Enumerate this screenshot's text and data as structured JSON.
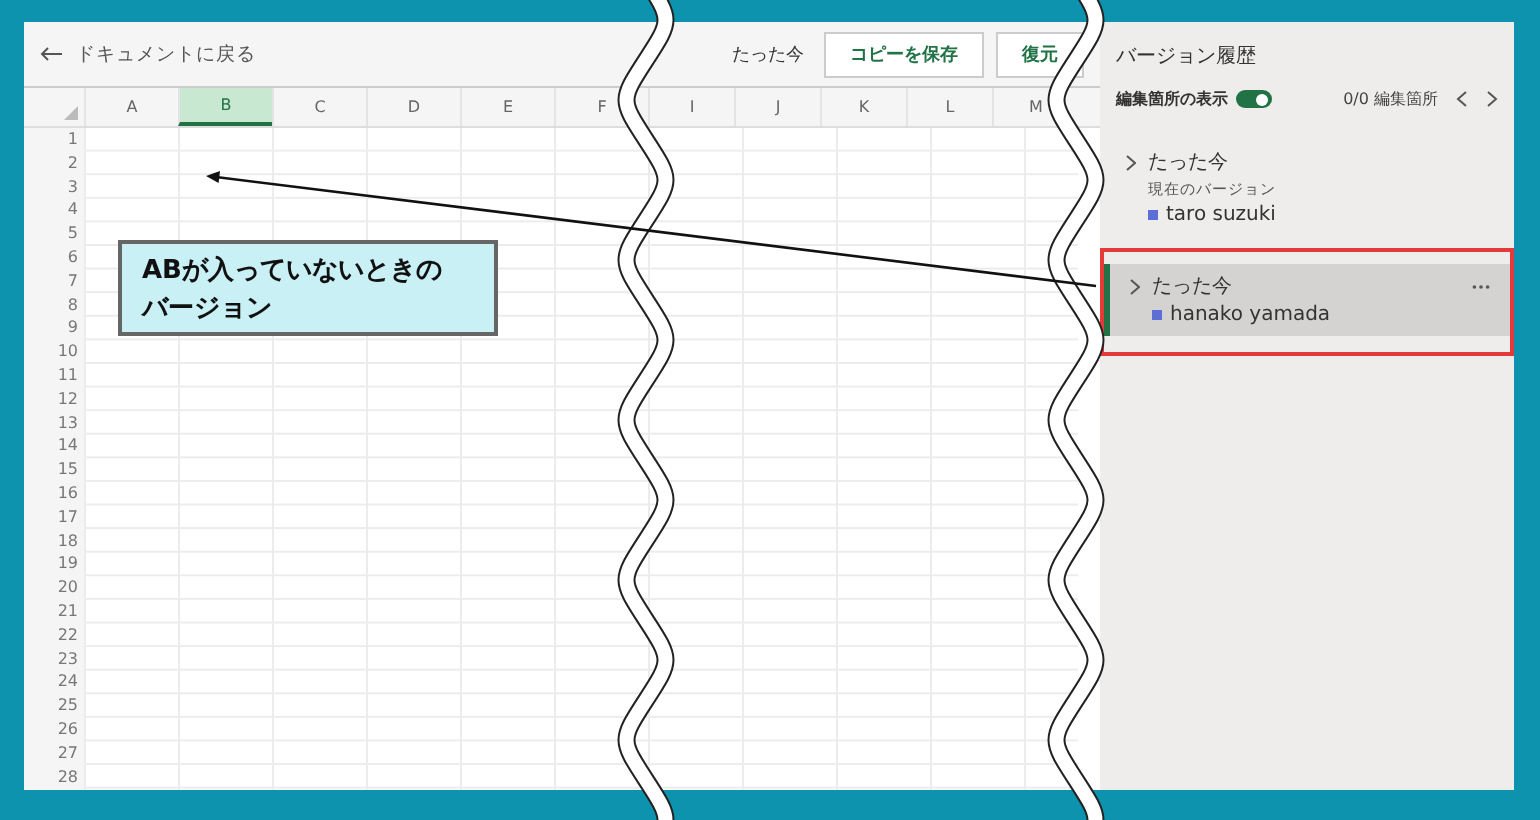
{
  "header": {
    "back_label": "ドキュメントに戻る",
    "time": "たった今",
    "buttons": [
      "コピーを保存",
      "復元"
    ]
  },
  "sheet": {
    "columns": [
      {
        "label": "A",
        "selected": false
      },
      {
        "label": "B",
        "selected": true
      },
      {
        "label": "C",
        "selected": false
      },
      {
        "label": "D",
        "selected": false
      },
      {
        "label": "E",
        "selected": false
      },
      {
        "label": "F",
        "selected": false
      },
      {
        "label": "I",
        "selected": false
      },
      {
        "label": "J",
        "selected": false
      },
      {
        "label": "K",
        "selected": false
      },
      {
        "label": "L",
        "selected": false
      },
      {
        "label": "M",
        "selected": false
      }
    ],
    "rows": [
      "1",
      "2",
      "3",
      "4",
      "5",
      "6",
      "7",
      "8",
      "9",
      "10",
      "11",
      "12",
      "13",
      "14",
      "15",
      "16",
      "17",
      "18",
      "19",
      "20",
      "21",
      "22",
      "23",
      "24",
      "25",
      "26",
      "27",
      "28"
    ]
  },
  "callout": "ABが入っていないときのバージョン",
  "panel": {
    "title": "バージョン履歴",
    "toggle_label": "編集箇所の表示",
    "toggle_on": true,
    "counter": "0/0 編集箇所",
    "versions": [
      {
        "time": "たった今",
        "subtitle": "現在のバージョン",
        "author": "taro suzuki",
        "color": "#5b6fd6",
        "selected": false,
        "annotated": false
      },
      {
        "time": "たった今",
        "author": "hanako yamada",
        "color": "#5b6fd6",
        "selected": true,
        "annotated": true
      }
    ]
  }
}
